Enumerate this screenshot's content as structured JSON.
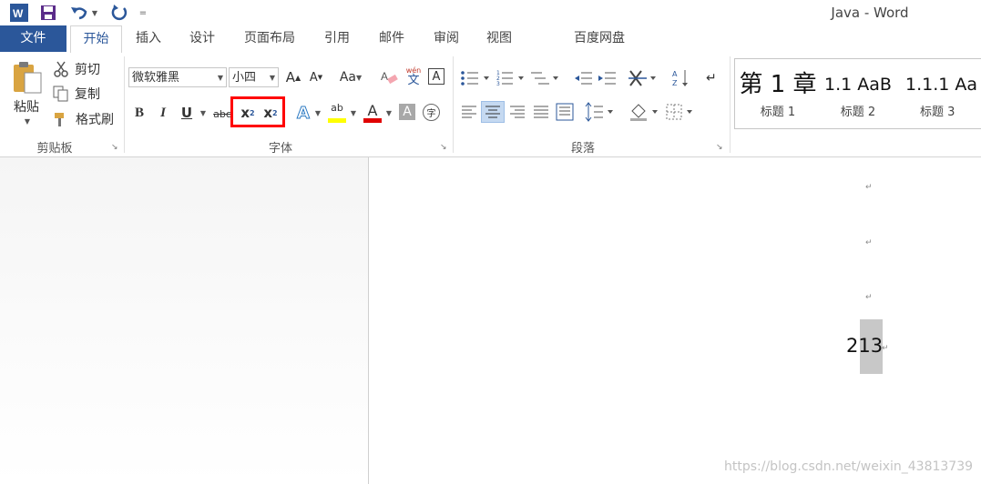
{
  "window": {
    "title": "Java - Word"
  },
  "qat": {
    "more": "="
  },
  "tabs": [
    {
      "label": "文件"
    },
    {
      "label": "开始"
    },
    {
      "label": "插入"
    },
    {
      "label": "设计"
    },
    {
      "label": "页面布局"
    },
    {
      "label": "引用"
    },
    {
      "label": "邮件"
    },
    {
      "label": "审阅"
    },
    {
      "label": "视图"
    },
    {
      "label": "百度网盘"
    }
  ],
  "clipboard": {
    "paste": "粘贴",
    "cut": "剪切",
    "copy": "复制",
    "format_painter": "格式刷",
    "group": "剪贴板"
  },
  "font": {
    "family": "微软雅黑",
    "size": "小四",
    "grow": "A",
    "shrink": "A",
    "change_case": "Aa",
    "phonetic_top": "wén",
    "phonetic_bottom": "文",
    "enclose": "A",
    "bold": "B",
    "italic": "I",
    "underline": "U",
    "strikethrough": "abc",
    "subscript": "x",
    "subscript_sub": "2",
    "superscript": "x",
    "superscript_sup": "2",
    "effects": "A",
    "highlight": "ab",
    "color": "A",
    "shading": "A",
    "enclosed_char": "字",
    "group": "字体",
    "highlight_color": "#ffff00",
    "font_color": "#e00000",
    "selection_box_color": "#ff0000"
  },
  "paragraph": {
    "group": "段落"
  },
  "styles": [
    {
      "preview": "第 1 章",
      "name": "标题 1"
    },
    {
      "preview": "1.1  AaB",
      "name": "标题 2"
    },
    {
      "preview": "1.1.1  Aa",
      "name": "标题 3"
    }
  ],
  "document": {
    "text": "213",
    "para_mark": "↵"
  },
  "watermark": "https://blog.csdn.net/weixin_43813739"
}
